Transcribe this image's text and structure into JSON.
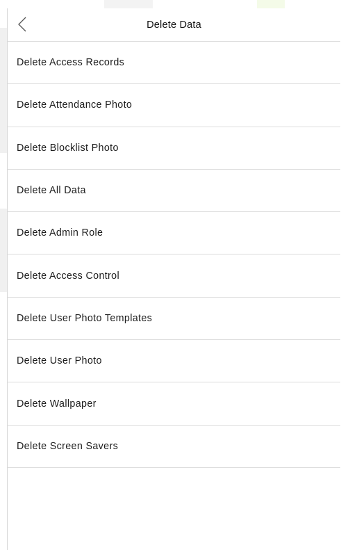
{
  "header": {
    "title": "Delete Data",
    "back_icon": "chevron-left-icon"
  },
  "menu": {
    "items": [
      {
        "label": "Delete Access Records"
      },
      {
        "label": "Delete Attendance Photo"
      },
      {
        "label": "Delete Blocklist Photo"
      },
      {
        "label": "Delete All Data"
      },
      {
        "label": "Delete Admin Role"
      },
      {
        "label": "Delete Access Control"
      },
      {
        "label": "Delete User Photo Templates"
      },
      {
        "label": "Delete User Photo"
      },
      {
        "label": "Delete Wallpaper"
      },
      {
        "label": "Delete Screen Savers"
      }
    ]
  },
  "colors": {
    "background": "#ffffff",
    "divider": "#dcdcdc",
    "text": "#1c1c1c"
  }
}
